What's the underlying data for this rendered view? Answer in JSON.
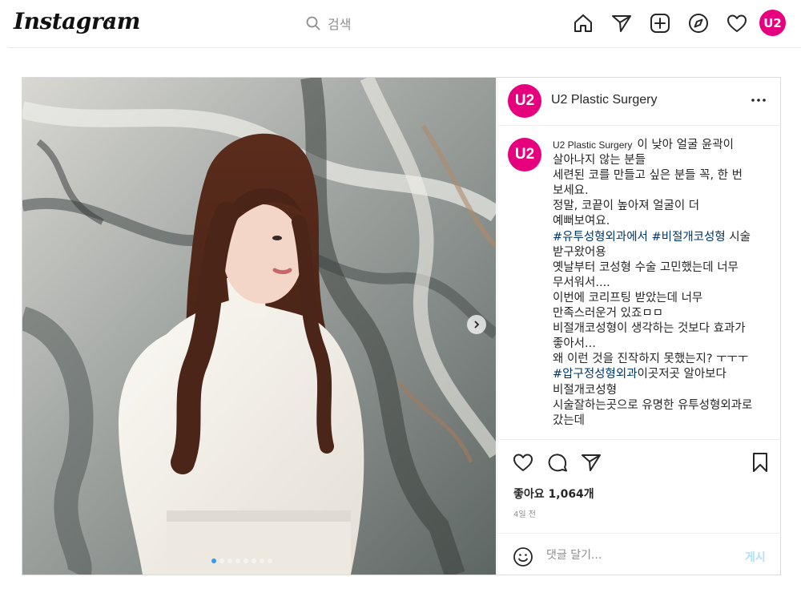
{
  "app": {
    "logo": "Instagram",
    "search_placeholder": "검색",
    "profile_avatar_text": "U2",
    "icons": [
      "home-icon",
      "direct-icon",
      "new-post-icon",
      "explore-icon",
      "activity-heart-icon",
      "profile-avatar"
    ]
  },
  "post": {
    "account": "U2 Plastic Surgery",
    "avatar_text": "U2",
    "caption_user": "U2 Plastic Surgery",
    "caption_first": "이 낮아 얼굴 윤곽이 살아나지 않는 분들",
    "caption_lines": [
      "세련된 코를 만들고 싶은 분들 꼭, 한 번 보세요.",
      "정말, 코끝이 높아져 얼굴이 더 예뻐보여요.",
      "",
      "옛날부터 코성형 수술 고민했는데 너무 무서워서....",
      "이번에 코리프팅 받았는데 너무 만족스러운거 있죠ㅁㅁ",
      "비절개코성형이 생각하는 것보다 효과가 좋아서...",
      "왜 이런 것을 진작하지 못했는지? ㅜㅜㅜ",
      "",
      "비절개코성형",
      "시술잘하는곳으로 유명한 유투성형외과로 갔는데"
    ],
    "hashtag_line_1": {
      "tag1": "#유투성형외과에서",
      "tag2": "#비절개코성형",
      "rest": "시술 받구왔어용"
    },
    "hashtag_line_2": {
      "tag": "#압구정성형외과",
      "rest": "이곳저곳 알아보다"
    },
    "likes": "좋아요 1,064개",
    "time": "4일 전",
    "comment_placeholder": "댓글 달기...",
    "post_button": "게시",
    "carousel": {
      "slides": 8,
      "current": 1
    }
  },
  "colors": {
    "brand": "#e6007e",
    "hashtag": "#00376b",
    "post_button_disabled": "#b2dffc"
  }
}
